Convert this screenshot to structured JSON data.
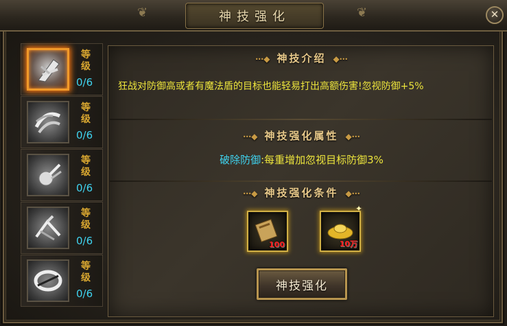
{
  "window": {
    "title": "神技强化",
    "close_glyph": "✕"
  },
  "skills": [
    {
      "level_label": "等级",
      "level_value": "0/6",
      "icon": "skill-claw-strike-icon",
      "selected": true
    },
    {
      "level_label": "等级",
      "level_value": "0/6",
      "icon": "skill-whirlwind-icon",
      "selected": false
    },
    {
      "level_label": "等级",
      "level_value": "0/6",
      "icon": "skill-fireball-icon",
      "selected": false
    },
    {
      "level_label": "等级",
      "level_value": "0/6",
      "icon": "skill-anchor-icon",
      "selected": false
    },
    {
      "level_label": "等级",
      "level_value": "0/6",
      "icon": "skill-ring-icon",
      "selected": false
    }
  ],
  "intro": {
    "title": "神技介绍",
    "text": "狂战对防御高或者有魔法盾的目标也能轻易打出高额伤害!忽视防御+5%"
  },
  "attributes": {
    "title": "神技强化属性",
    "name": "破除防御",
    "desc": ":每重增加忽视目标防御3%"
  },
  "conditions": {
    "title": "神技强化条件",
    "items": [
      {
        "icon": "scroll-book-icon",
        "count": "100"
      },
      {
        "icon": "gold-ingot-icon",
        "count": "10万"
      }
    ]
  },
  "enhance_button": "神技强化",
  "colors": {
    "level_value": "#3fd3ef",
    "desc_text": "#ece43c",
    "section_title": "#e8c98a",
    "selected_glow": "#f19a2a"
  }
}
